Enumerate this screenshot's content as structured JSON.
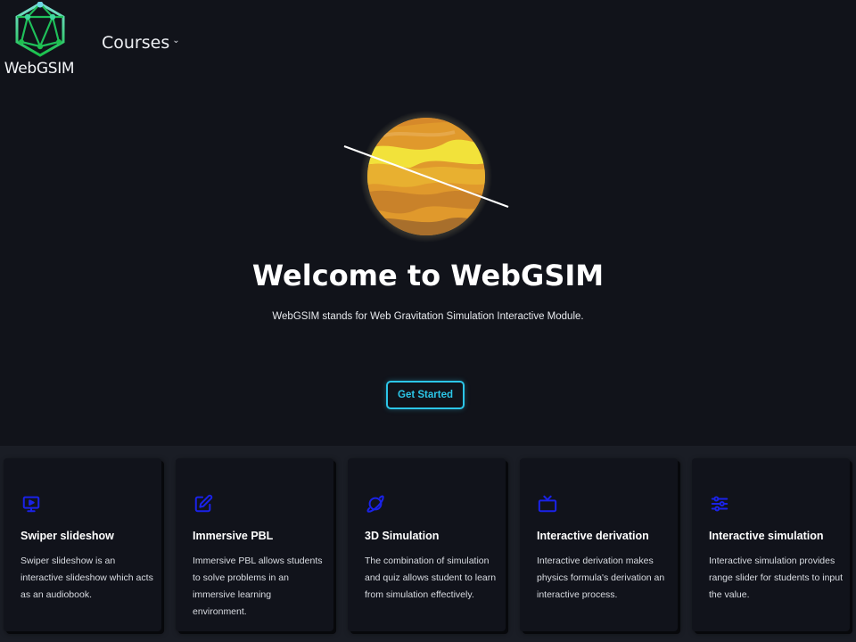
{
  "header": {
    "logo_text": "WebGSIM",
    "nav": {
      "courses_label": "Courses",
      "chevron": "chevron-down-icon"
    }
  },
  "hero": {
    "title": "Welcome to WebGSIM",
    "subtitle": "WebGSIM stands for Web Gravitation Simulation Interactive Module.",
    "cta_label": "Get Started"
  },
  "colors": {
    "background": "#11131a",
    "accent": "#2cc6e8",
    "icon_blue": "#1a22e8",
    "logo_green": "#22c55e"
  },
  "features": [
    {
      "icon": "presentation-screen-icon",
      "title": "Swiper slideshow",
      "desc": "Swiper slideshow is an interactive slideshow which acts as an audiobook."
    },
    {
      "icon": "edit-square-icon",
      "title": "Immersive PBL",
      "desc": "Immersive PBL allows students to solve problems in an immersive learning environment."
    },
    {
      "icon": "planet-icon",
      "title": "3D Simulation",
      "desc": "The combination of simulation and quiz allows student to learn from simulation effectively."
    },
    {
      "icon": "tv-icon",
      "title": "Interactive derivation",
      "desc": "Interactive derivation makes physics formula's derivation an interactive process."
    },
    {
      "icon": "sliders-icon",
      "title": "Interactive simulation",
      "desc": "Interactive simulation provides range slider for students to input the value."
    }
  ]
}
